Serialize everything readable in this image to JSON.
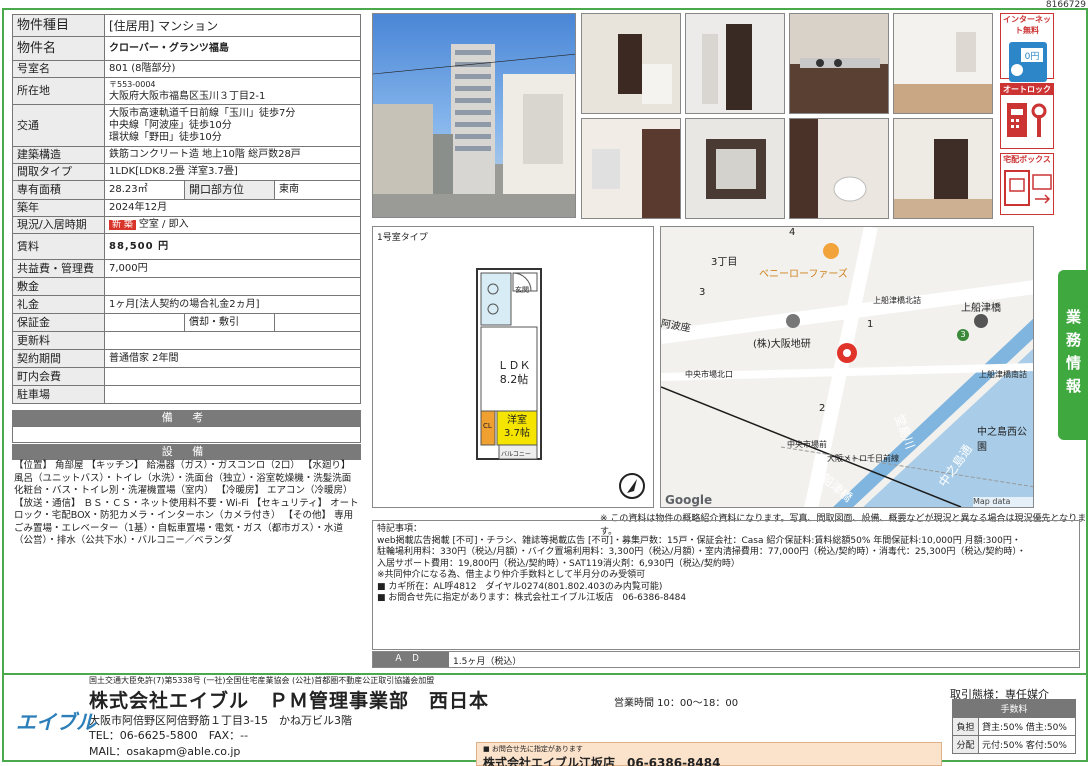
{
  "doc_id": "8166729",
  "property": {
    "type_label": "物件種目",
    "type_value": "[住居用] マンション",
    "name_label": "物件名",
    "name_value": "クローバー・グランツ福島",
    "room_label": "号室名",
    "room_value": "801 (8階部分)",
    "address_label": "所在地",
    "postal": "〒553-0004",
    "address_value": "大阪府大阪市福島区玉川３丁目2-1",
    "transport_label": "交通",
    "transport_lines": [
      "大阪市高速軌道千日前線「玉川」徒歩7分",
      "中央線「阿波座」徒歩10分",
      "環状線「野田」徒歩10分"
    ],
    "structure_label": "建築構造",
    "structure_value": "鉄筋コンクリート造 地上10階 総戸数28戸",
    "layout_label": "間取タイプ",
    "layout_value": "1LDK[LDK8.2畳 洋室3.7畳]",
    "area_label": "専有面積",
    "area_value": "28.23㎡",
    "window_label": "開口部方位",
    "window_value": "東南",
    "built_label": "築年",
    "built_value": "2024年12月",
    "status_label": "現況/入居時期",
    "status_badge": "新 築",
    "status_value": "空室 / 即入",
    "rent_label": "賃料",
    "rent_value": "88,500 円",
    "common_label": "共益費・管理費",
    "common_value": "7,000円",
    "shikikin_label": "敷金",
    "shikikin_value": "",
    "reikin_label": "礼金",
    "reikin_value": "1ヶ月[法人契約の場合礼金2ヵ月]",
    "hoshokin_label": "保証金",
    "hoshokin_value": "",
    "shikibiki_label": "償却・敷引",
    "shikibiki_value": "",
    "renewal_label": "更新料",
    "renewal_value": "",
    "contract_label": "契約期間",
    "contract_value": "普通借家 2年間",
    "town_label": "町内会費",
    "town_value": "",
    "parking_label": "駐車場",
    "parking_value": ""
  },
  "sections": {
    "bikou": "備 考",
    "setsubi": "設 備",
    "setsubi_text": "【位置】 角部屋 【キッチン】 給湯器（ガス）・ガスコンロ（2口） 【水廻り】 風呂（ユニットバス）・トイレ（水洗）・洗面台（独立）・浴室乾燥機・洗髪洗面化粧台・バス・トイレ別・洗濯機置場（室内） 【冷暖房】 エアコン（冷暖房） 【放送・通信】 ＢＳ・ＣＳ・ネット使用料不要・Wi-Fi 【セキュリティ】 オートロック・宅配BOX・防犯カメラ・インターホン（カメラ付き） 【その他】 専用ごみ置場・エレベーター（1基）・自転車置場・電気・ガス（都市ガス）・水道（公営）・排水（公共下水）・バルコニー／ベランダ"
  },
  "icons": {
    "internet": "インターネット無料",
    "internet_sub": "0円",
    "autolock": "オートロック",
    "delivery": "宅配ボックス"
  },
  "side_tab": "業務情報",
  "floorplan": {
    "caption": "1号室タイプ",
    "ldk": "ＬＤＫ",
    "ldk_size": "8.2帖",
    "youshitsu": "洋室",
    "youshitsu_size": "3.7帖",
    "entrance": "玄関",
    "balcony": "バルコニー",
    "cl": "CL"
  },
  "map": {
    "labels": [
      "3丁目",
      "ベニーローファーズ",
      "上船津橋北詰",
      "上船津橋",
      "(株)大阪地研",
      "中央市場北口",
      "中央市場前",
      "大阪メトロ千日前線",
      "上船津橋南詰",
      "中之島西公園",
      "堂島川",
      "中之島通",
      "船津橋",
      "阿波座"
    ],
    "numbers": [
      "4",
      "3",
      "1",
      "2",
      "3"
    ],
    "google": "Google",
    "copyright": "Map data ©2025"
  },
  "notice": "※ この資料は物件の概略紹介資料になります。写真、間取図面、設備、概要などが現況と異なる場合は現況優先となります。",
  "tokki": {
    "title": "特記事項：",
    "lines": [
      "web掲載広告掲載 [不可]・チラシ、雑誌等掲載広告 [不可]・募集戸数：15戸・保証会社：Casa 紹介保証料:賃料総額50% 年間保証料:10,000円 月額:300円・",
      "駐輪場利用料：330円（税込/月額）・バイク置場利用料：3,300円（税込/月額）・室内清掃費用：77,000円（税込/契約時）・消毒代：25,300円（税込/契約時）・",
      "入居サポート費用：19,800円（税込/契約時）・SAT119消火剤：6,930円（税込/契約時）",
      "※共同仲介になる為、借主より仲介手数料として半月分のみ受領可",
      "■ カギ所在：AL呼4812　ダイヤル0274(801.802.403のみ内覧可能)",
      "■ お問合せ先に指定があります：株式会社エイブル江坂店　06-6386-8484"
    ]
  },
  "ad": {
    "label": "ＡＤ",
    "value": "1.5ヶ月（税込）"
  },
  "footer": {
    "license": "国土交通大臣免許(7)第5338号 (一社)全国住宅産業協会 (公社)首都圏不動産公正取引協議会加盟",
    "company": "株式会社エイブル　ＰＭ管理事業部　西日本",
    "address": "大阪市阿倍野区阿倍野筋１丁目3-15　かね万ビル3階",
    "tel": "TEL：06-6625-5800　FAX：--",
    "mail": "MAIL：osakapm@able.co.jp",
    "logo": "エイブル",
    "hours": "営業時間 10：00〜18：00",
    "torihiki": "取引態様：専任媒介",
    "fee_header": "手数料",
    "fee_rows": [
      {
        "k": "負担",
        "v": "貸主:50%  借主:50%"
      },
      {
        "k": "分配",
        "v": "元付:50%  客付:50%"
      }
    ],
    "contact_small": "■ お問合せ先に指定があります",
    "contact_name": "株式会社エイブル江坂店　06-6386-8484"
  },
  "colors": {
    "frame": "#4aa94a",
    "badge": "#d9362b",
    "yellow": "#f4e400",
    "pin": "#e0342b"
  }
}
